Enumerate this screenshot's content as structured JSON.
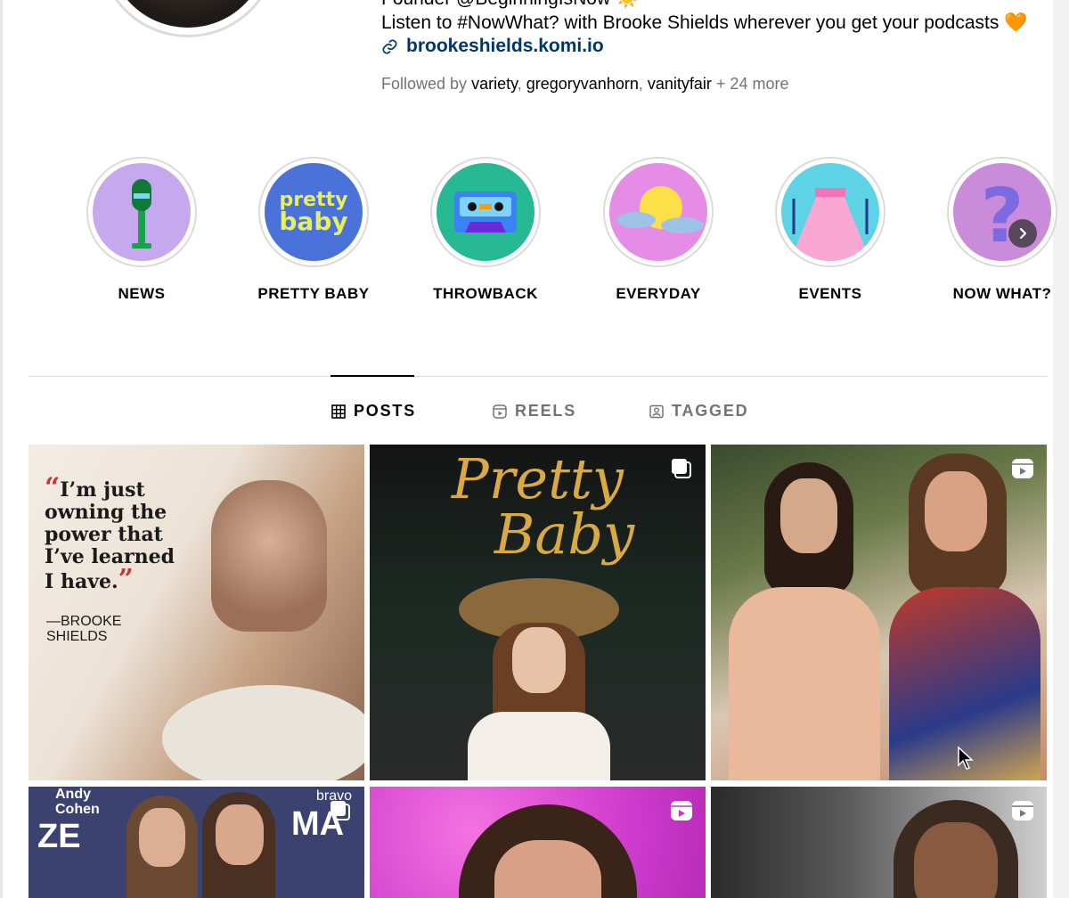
{
  "profile": {
    "bio_line1": "Founder @BeginningIsNow ☀️",
    "bio_line2": "Listen to #NowWhat? with Brooke Shields wherever you get your podcasts 🧡",
    "link": "brookeshields.komi.io",
    "followed_by_prefix": "Followed by",
    "followed_by_users": [
      "variety",
      "gregoryvanhorn",
      "vanityfair"
    ],
    "followed_by_more": "+ 24 more"
  },
  "highlights": [
    {
      "label": "NEWS",
      "icon": "microphone-icon",
      "bg": "#c6a8ee"
    },
    {
      "label": "PRETTY BABY",
      "icon": "pretty-baby-text",
      "bg": "#4a72d8",
      "cover_text_1": "pretty",
      "cover_text_2": "baby"
    },
    {
      "label": "THROWBACK",
      "icon": "cassette-icon",
      "bg": "#27b993"
    },
    {
      "label": "EVERYDAY",
      "icon": "sun-clouds-icon",
      "bg": "#e48ce6"
    },
    {
      "label": "EVENTS",
      "icon": "red-carpet-icon",
      "bg": "#5fd3e6"
    },
    {
      "label": "NOW WHAT?",
      "icon": "question-mark-icon",
      "bg": "#c98bda"
    }
  ],
  "tabs": [
    {
      "label": "POSTS",
      "icon": "grid-icon",
      "active": true
    },
    {
      "label": "REELS",
      "icon": "reels-icon",
      "active": false
    },
    {
      "label": "TAGGED",
      "icon": "tagged-icon",
      "active": false
    }
  ],
  "posts": [
    {
      "type": "photo",
      "quote_open": "“",
      "quote_text": "I’m just owning the power that I’ve learned I have.",
      "quote_close": "”",
      "attribution_1": "—BROOKE",
      "attribution_2": "SHIELDS"
    },
    {
      "type": "carousel",
      "title_1": "Pretty",
      "title_2": "Baby"
    },
    {
      "type": "reel"
    },
    {
      "type": "carousel",
      "sign_text_1": "Andy",
      "sign_text_2": "Cohen",
      "sign_text_3": "bravo",
      "sign_text_4": "MA",
      "sign_text_5": "ZE"
    },
    {
      "type": "reel"
    },
    {
      "type": "reel"
    }
  ],
  "colors": {
    "link": "#00376b",
    "muted": "#737373",
    "border": "#dbdbdb"
  }
}
